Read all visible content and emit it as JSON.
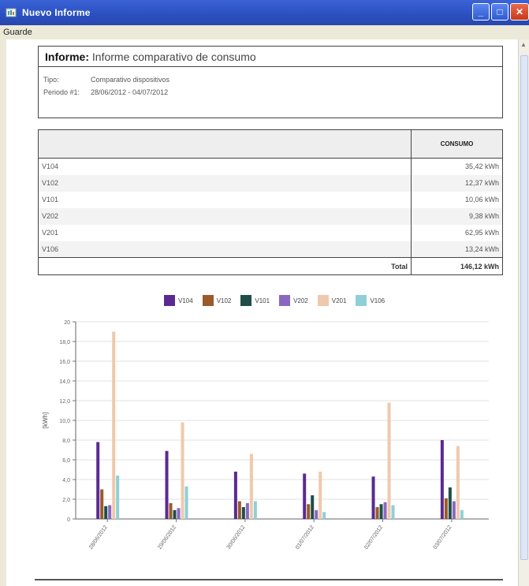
{
  "window": {
    "title": "Nuevo Informe",
    "menu": [
      "Guarde"
    ],
    "buttons": {
      "minimize": "_",
      "maximize": "□",
      "close": "✕"
    }
  },
  "report": {
    "label": "Informe:",
    "title": "Informe comparativo de consumo",
    "type_label": "Tipo:",
    "type_value": "Comparativo dispositivos",
    "period_label": "Periodo #1:",
    "period_value": "28/06/2012 - 04/07/2012"
  },
  "table": {
    "header_name": "",
    "header_value": "CONSUMO",
    "rows": [
      {
        "name": "V104",
        "value": "35,42 kWh"
      },
      {
        "name": "V102",
        "value": "12,37 kWh"
      },
      {
        "name": "V101",
        "value": "10,06 kWh"
      },
      {
        "name": "V202",
        "value": "9,38 kWh"
      },
      {
        "name": "V201",
        "value": "62,95 kWh"
      },
      {
        "name": "V106",
        "value": "13,24 kWh"
      }
    ],
    "total_label": "Total",
    "total_value": "146,12 kWh"
  },
  "colors": {
    "V104": "#5b2a91",
    "V102": "#9a5a2a",
    "V101": "#1f4e48",
    "V202": "#8a68c0",
    "V201": "#efc9ad",
    "V106": "#8fd0d6"
  },
  "chart_data": {
    "type": "bar",
    "ylabel": "[kWh]",
    "ylim": [
      0,
      20
    ],
    "ytick_labels": [
      "0",
      "2,0",
      "4,0",
      "6,0",
      "8,0",
      "10,0",
      "12,0",
      "14,0",
      "16,0",
      "18,0",
      "20"
    ],
    "categories": [
      "28/06/2012",
      "29/06/2012",
      "30/06/2012",
      "01/07/2012",
      "02/07/2012",
      "03/07/2012"
    ],
    "series": [
      {
        "name": "V104",
        "values": [
          7.8,
          6.9,
          4.8,
          4.6,
          4.3,
          8.0
        ]
      },
      {
        "name": "V102",
        "values": [
          3.0,
          1.6,
          1.8,
          1.5,
          1.2,
          2.1
        ]
      },
      {
        "name": "V101",
        "values": [
          1.3,
          0.9,
          1.2,
          2.4,
          1.5,
          3.2
        ]
      },
      {
        "name": "V202",
        "values": [
          1.4,
          1.1,
          1.6,
          0.9,
          1.7,
          1.8
        ]
      },
      {
        "name": "V201",
        "values": [
          19.0,
          9.8,
          6.6,
          4.8,
          11.8,
          7.4
        ]
      },
      {
        "name": "V106",
        "values": [
          4.4,
          3.3,
          1.8,
          0.7,
          1.4,
          0.9
        ]
      }
    ],
    "legend_position": "top-center",
    "grid": true
  }
}
